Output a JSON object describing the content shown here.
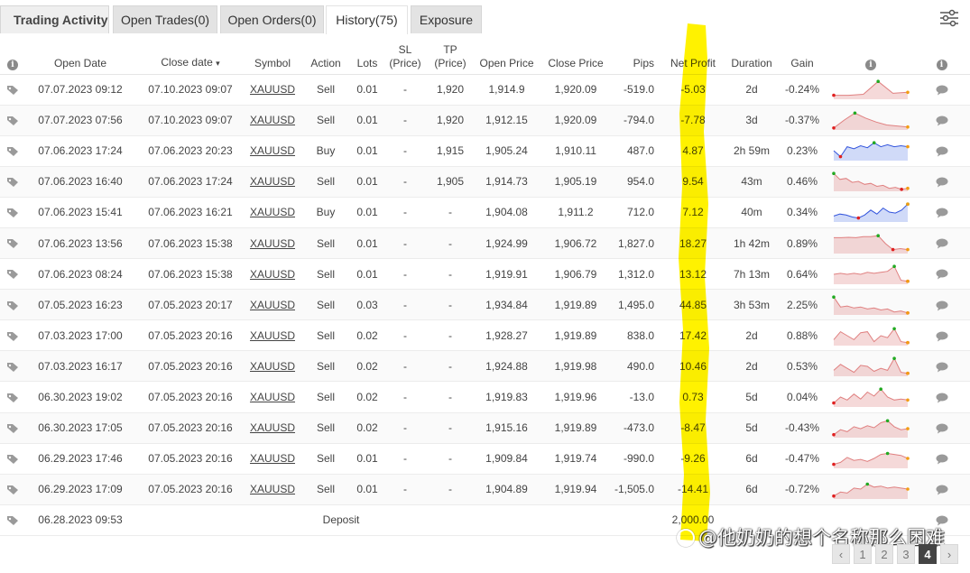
{
  "tabs": [
    {
      "label": "Trading Activity"
    },
    {
      "label": "Open Trades(0)"
    },
    {
      "label": "Open Orders(0)"
    },
    {
      "label": "History(75)"
    },
    {
      "label": "Exposure"
    }
  ],
  "active_tab": "History(75)",
  "columns": {
    "open_date": "Open Date",
    "close_date": "Close date",
    "close_date_sort": "▾",
    "symbol": "Symbol",
    "action": "Action",
    "lots": "Lots",
    "sl_1": "SL",
    "sl_2": "(Price)",
    "tp_1": "TP",
    "tp_2": "(Price)",
    "open_price": "Open Price",
    "close_price": "Close Price",
    "pips": "Pips",
    "net_profit": "Net Profit",
    "duration": "Duration",
    "gain": "Gain"
  },
  "rows": [
    {
      "open": "07.07.2023 09:12",
      "close": "07.10.2023 09:07",
      "symbol": "XAUUSD",
      "action": "Sell",
      "lots": "0.01",
      "sl": "-",
      "tp": "1,920",
      "open_price": "1,914.9",
      "close_price": "1,920.09",
      "pips": "-519.0",
      "profit": "-5.03",
      "duration": "2d",
      "gain": "-0.24%",
      "sign": "neg",
      "spark": {
        "kind": "red",
        "values": [
          0.2,
          0.2,
          0.25,
          0.9,
          0.3,
          0.35
        ]
      }
    },
    {
      "open": "07.07.2023 07:56",
      "close": "07.10.2023 09:07",
      "symbol": "XAUUSD",
      "action": "Sell",
      "lots": "0.01",
      "sl": "-",
      "tp": "1,920",
      "open_price": "1,912.15",
      "close_price": "1,920.09",
      "pips": "-794.0",
      "profit": "-7.78",
      "duration": "3d",
      "gain": "-0.37%",
      "sign": "neg",
      "spark": {
        "kind": "red",
        "values": [
          0.1,
          0.5,
          0.85,
          0.6,
          0.4,
          0.25,
          0.2,
          0.15
        ]
      }
    },
    {
      "open": "07.06.2023 17:24",
      "close": "07.06.2023 20:23",
      "symbol": "XAUUSD",
      "action": "Buy",
      "lots": "0.01",
      "sl": "-",
      "tp": "1,915",
      "open_price": "1,905.24",
      "close_price": "1,910.11",
      "pips": "487.0",
      "profit": "4.87",
      "duration": "2h 59m",
      "gain": "0.23%",
      "sign": "pos",
      "spark": {
        "kind": "blue",
        "values": [
          0.5,
          0.2,
          0.7,
          0.6,
          0.75,
          0.65,
          0.9,
          0.7,
          0.8,
          0.7,
          0.75,
          0.7
        ]
      }
    },
    {
      "open": "07.06.2023 16:40",
      "close": "07.06.2023 17:24",
      "symbol": "XAUUSD",
      "action": "Sell",
      "lots": "0.01",
      "sl": "-",
      "tp": "1,905",
      "open_price": "1,914.73",
      "close_price": "1,905.19",
      "pips": "954.0",
      "profit": "9.54",
      "duration": "43m",
      "gain": "0.46%",
      "sign": "pos",
      "spark": {
        "kind": "red",
        "values": [
          0.9,
          0.6,
          0.65,
          0.45,
          0.5,
          0.35,
          0.4,
          0.25,
          0.3,
          0.15,
          0.2,
          0.1,
          0.15
        ]
      }
    },
    {
      "open": "07.06.2023 15:41",
      "close": "07.06.2023 16:21",
      "symbol": "XAUUSD",
      "action": "Buy",
      "lots": "0.01",
      "sl": "-",
      "tp": "-",
      "open_price": "1,904.08",
      "close_price": "1,911.2",
      "pips": "712.0",
      "profit": "7.12",
      "duration": "40m",
      "gain": "0.34%",
      "sign": "pos",
      "spark": {
        "kind": "blue",
        "values": [
          0.3,
          0.4,
          0.35,
          0.25,
          0.2,
          0.35,
          0.6,
          0.4,
          0.7,
          0.5,
          0.45,
          0.6,
          0.9
        ]
      }
    },
    {
      "open": "07.06.2023 13:56",
      "close": "07.06.2023 15:38",
      "symbol": "XAUUSD",
      "action": "Sell",
      "lots": "0.01",
      "sl": "-",
      "tp": "-",
      "open_price": "1,924.99",
      "close_price": "1,906.72",
      "pips": "1,827.0",
      "profit": "18.27",
      "duration": "1h 42m",
      "gain": "0.89%",
      "sign": "pos",
      "spark": {
        "kind": "red",
        "values": [
          0.8,
          0.8,
          0.82,
          0.8,
          0.85,
          0.85,
          0.9,
          0.5,
          0.2,
          0.25,
          0.2
        ]
      }
    },
    {
      "open": "07.06.2023 08:24",
      "close": "07.06.2023 15:38",
      "symbol": "XAUUSD",
      "action": "Sell",
      "lots": "0.01",
      "sl": "-",
      "tp": "-",
      "open_price": "1,919.91",
      "close_price": "1,906.79",
      "pips": "1,312.0",
      "profit": "13.12",
      "duration": "7h 13m",
      "gain": "0.64%",
      "sign": "pos",
      "spark": {
        "kind": "red",
        "values": [
          0.5,
          0.55,
          0.5,
          0.55,
          0.5,
          0.6,
          0.55,
          0.6,
          0.65,
          0.9,
          0.2,
          0.15
        ]
      }
    },
    {
      "open": "07.05.2023 16:23",
      "close": "07.05.2023 20:17",
      "symbol": "XAUUSD",
      "action": "Sell",
      "lots": "0.03",
      "sl": "-",
      "tp": "-",
      "open_price": "1,934.84",
      "close_price": "1,919.89",
      "pips": "1,495.0",
      "profit": "44.85",
      "duration": "3h 53m",
      "gain": "2.25%",
      "sign": "pos",
      "spark": {
        "kind": "red",
        "values": [
          0.9,
          0.4,
          0.45,
          0.35,
          0.4,
          0.3,
          0.35,
          0.25,
          0.3,
          0.15,
          0.2,
          0.1
        ]
      }
    },
    {
      "open": "07.03.2023 17:00",
      "close": "07.05.2023 20:16",
      "symbol": "XAUUSD",
      "action": "Sell",
      "lots": "0.02",
      "sl": "-",
      "tp": "-",
      "open_price": "1,928.27",
      "close_price": "1,919.89",
      "pips": "838.0",
      "profit": "17.42",
      "duration": "2d",
      "gain": "0.88%",
      "sign": "pos",
      "spark": {
        "kind": "red",
        "values": [
          0.3,
          0.7,
          0.5,
          0.3,
          0.65,
          0.7,
          0.2,
          0.5,
          0.4,
          0.85,
          0.2,
          0.15
        ]
      }
    },
    {
      "open": "07.03.2023 16:17",
      "close": "07.05.2023 20:16",
      "symbol": "XAUUSD",
      "action": "Sell",
      "lots": "0.02",
      "sl": "-",
      "tp": "-",
      "open_price": "1,924.88",
      "close_price": "1,919.98",
      "pips": "490.0",
      "profit": "10.46",
      "duration": "2d",
      "gain": "0.53%",
      "sign": "pos",
      "spark": {
        "kind": "red",
        "values": [
          0.3,
          0.6,
          0.4,
          0.2,
          0.55,
          0.5,
          0.25,
          0.4,
          0.3,
          0.9,
          0.2,
          0.15
        ]
      }
    },
    {
      "open": "06.30.2023 19:02",
      "close": "07.05.2023 20:16",
      "symbol": "XAUUSD",
      "action": "Sell",
      "lots": "0.02",
      "sl": "-",
      "tp": "-",
      "open_price": "1,919.83",
      "close_price": "1,919.96",
      "pips": "-13.0",
      "profit": "0.73",
      "duration": "5d",
      "gain": "0.04%",
      "sign": "pos",
      "spark": {
        "kind": "red",
        "values": [
          0.2,
          0.5,
          0.35,
          0.65,
          0.4,
          0.75,
          0.55,
          0.9,
          0.5,
          0.35,
          0.4,
          0.35
        ]
      }
    },
    {
      "open": "06.30.2023 17:05",
      "close": "07.05.2023 20:16",
      "symbol": "XAUUSD",
      "action": "Sell",
      "lots": "0.02",
      "sl": "-",
      "tp": "-",
      "open_price": "1,915.16",
      "close_price": "1,919.89",
      "pips": "-473.0",
      "profit": "-8.47",
      "duration": "5d",
      "gain": "-0.43%",
      "sign": "neg",
      "spark": {
        "kind": "red",
        "values": [
          0.15,
          0.4,
          0.3,
          0.55,
          0.45,
          0.6,
          0.5,
          0.75,
          0.85,
          0.55,
          0.4,
          0.45
        ]
      }
    },
    {
      "open": "06.29.2023 17:46",
      "close": "07.05.2023 20:16",
      "symbol": "XAUUSD",
      "action": "Sell",
      "lots": "0.01",
      "sl": "-",
      "tp": "-",
      "open_price": "1,909.84",
      "close_price": "1,919.74",
      "pips": "-990.0",
      "profit": "-9.26",
      "duration": "6d",
      "gain": "-0.47%",
      "sign": "neg",
      "spark": {
        "kind": "red",
        "values": [
          0.2,
          0.3,
          0.55,
          0.4,
          0.45,
          0.35,
          0.5,
          0.7,
          0.75,
          0.7,
          0.65,
          0.5
        ]
      }
    },
    {
      "open": "06.29.2023 17:09",
      "close": "07.05.2023 20:16",
      "symbol": "XAUUSD",
      "action": "Sell",
      "lots": "0.01",
      "sl": "-",
      "tp": "-",
      "open_price": "1,904.89",
      "close_price": "1,919.94",
      "pips": "-1,505.0",
      "profit": "-14.41",
      "duration": "6d",
      "gain": "-0.72%",
      "sign": "neg",
      "spark": {
        "kind": "red",
        "values": [
          0.15,
          0.35,
          0.3,
          0.55,
          0.5,
          0.75,
          0.6,
          0.65,
          0.55,
          0.6,
          0.55,
          0.5
        ]
      }
    }
  ],
  "deposit_row": {
    "open": "06.28.2023 09:53",
    "action": "Deposit",
    "profit": "2,000.00"
  },
  "pager": {
    "prev": "‹",
    "pages": [
      "1",
      "2",
      "3",
      "4"
    ],
    "active": "4",
    "next": "›"
  },
  "watermark": "@他奶奶的想个名称那么困难",
  "colors": {
    "positive": "#1a9a1a",
    "negative": "#e53935",
    "deposit": "#e8a317",
    "highlight": "#ffee00",
    "spark_red": "#e08080",
    "spark_blue": "#3355dd"
  }
}
